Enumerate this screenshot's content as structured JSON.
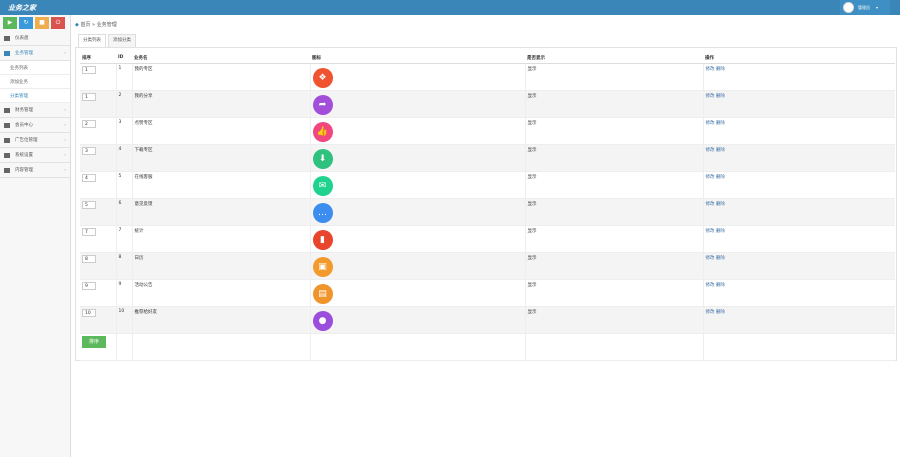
{
  "app": {
    "logo": "业务之家",
    "user": "管理员"
  },
  "sidebar": {
    "buttons": [
      {
        "icon": "play-icon",
        "color": "#5cb85c",
        "glyph": "▶"
      },
      {
        "icon": "refresh-icon",
        "color": "#3a9ad9",
        "glyph": "↻"
      },
      {
        "icon": "box-icon",
        "color": "#f0ad4e",
        "glyph": "■"
      },
      {
        "icon": "power-icon",
        "color": "#d9534f",
        "glyph": "⏻"
      }
    ],
    "items": [
      {
        "label": "仪表盘"
      },
      {
        "label": "业务管理",
        "sub": [
          "业务列表",
          "添加业务",
          "分类管理"
        ]
      },
      {
        "label": "财务管理"
      },
      {
        "label": "会员中心"
      },
      {
        "label": "广告位管理"
      },
      {
        "label": "系统设置"
      },
      {
        "label": "内容管理"
      }
    ]
  },
  "breadcrumb": "首页 » 业务管理",
  "tabs": [
    "分类列表",
    "添加分类"
  ],
  "table": {
    "headers": [
      "排序",
      "ID",
      "业务名",
      "图标",
      "是否显示",
      "操作"
    ],
    "rows": [
      {
        "sort": "1",
        "id": "1",
        "name": "我的专区",
        "color": "#f0532f",
        "glyph": "❖",
        "show": "显示",
        "ops": "修改 删除"
      },
      {
        "sort": "1",
        "id": "2",
        "name": "我的分享",
        "color": "#a34ddb",
        "glyph": "➦",
        "show": "显示",
        "ops": "修改 删除"
      },
      {
        "sort": "2",
        "id": "3",
        "name": "点赞专区",
        "color": "#f0477f",
        "glyph": "👍",
        "show": "显示",
        "ops": "修改 删除"
      },
      {
        "sort": "3",
        "id": "4",
        "name": "下载专区",
        "color": "#2ec27e",
        "glyph": "⬇",
        "show": "显示",
        "ops": "修改 删除"
      },
      {
        "sort": "4",
        "id": "5",
        "name": "在线客服",
        "color": "#1fd38f",
        "glyph": "✉",
        "show": "显示",
        "ops": "修改 删除"
      },
      {
        "sort": "5",
        "id": "6",
        "name": "意见反馈",
        "color": "#3c8df0",
        "glyph": "…",
        "show": "显示",
        "ops": "修改 删除"
      },
      {
        "sort": "7",
        "id": "7",
        "name": "统计",
        "color": "#e8452c",
        "glyph": "▮",
        "show": "显示",
        "ops": "修改 删除"
      },
      {
        "sort": "8",
        "id": "8",
        "name": "日历",
        "color": "#f39a2c",
        "glyph": "▣",
        "show": "显示",
        "ops": "修改 删除"
      },
      {
        "sort": "9",
        "id": "9",
        "name": "活动公告",
        "color": "#f0952b",
        "glyph": "▤",
        "show": "显示",
        "ops": "修改 删除"
      },
      {
        "sort": "10",
        "id": "10",
        "name": "推荐给好友",
        "color": "#9b4ddb",
        "glyph": "●",
        "show": "显示",
        "ops": "修改 删除"
      }
    ]
  },
  "sort_button": "排序"
}
